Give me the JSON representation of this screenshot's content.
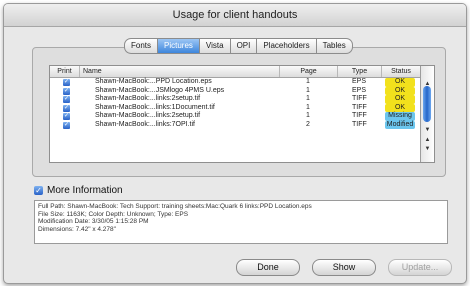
{
  "dialog": {
    "title": "Usage for client handouts",
    "tabs": [
      "Fonts",
      "Pictures",
      "Vista",
      "OPI",
      "Placeholders",
      "Tables"
    ],
    "selected_tab": "Pictures"
  },
  "table": {
    "columns": [
      "Print",
      "Name",
      "Page",
      "Type",
      "Status"
    ],
    "rows": [
      {
        "print": true,
        "name": "Shawn-MacBook:...PPD Location.eps",
        "page": "1",
        "type": "EPS",
        "status": "OK",
        "status_color": "#f2e11c"
      },
      {
        "print": true,
        "name": "Shawn-MacBook:...JSMlogo 4PMS U.eps",
        "page": "1",
        "type": "EPS",
        "status": "OK",
        "status_color": "#f2e11c"
      },
      {
        "print": true,
        "name": "Shawn-MacBook:...links:2setup.tif",
        "page": "1",
        "type": "TIFF",
        "status": "OK",
        "status_color": "#f2e11c"
      },
      {
        "print": true,
        "name": "Shawn-MacBook:...links:1Document.tif",
        "page": "1",
        "type": "TIFF",
        "status": "OK",
        "status_color": "#f2e11c"
      },
      {
        "print": true,
        "name": "Shawn-MacBook:...links:2setup.tif",
        "page": "1",
        "type": "TIFF",
        "status": "Missing",
        "status_color": "#6cc6ee"
      },
      {
        "print": true,
        "name": "Shawn-MacBook:...links:7OPI.tif",
        "page": "2",
        "type": "TIFF",
        "status": "Modified",
        "status_color": "#6cc6ee"
      }
    ]
  },
  "more_info": {
    "label": "More Information",
    "checked": true,
    "lines": [
      "Full Path:  Shawn-MacBook: Tech Support: training sheets:Mac:Quark 6 links:PPD Location.eps",
      "File Size:  1163K;  Color Depth: Unknown;  Type: EPS",
      "Modification Date:  3/30/05  1:15:28 PM",
      "Dimensions: 7.42\" x 4.278\""
    ]
  },
  "buttons": {
    "done": "Done",
    "show": "Show",
    "update": "Update..."
  },
  "colors": {
    "accent": "#3d86dc",
    "status_ok": "#f2e11c",
    "status_alert": "#6cc6ee"
  }
}
